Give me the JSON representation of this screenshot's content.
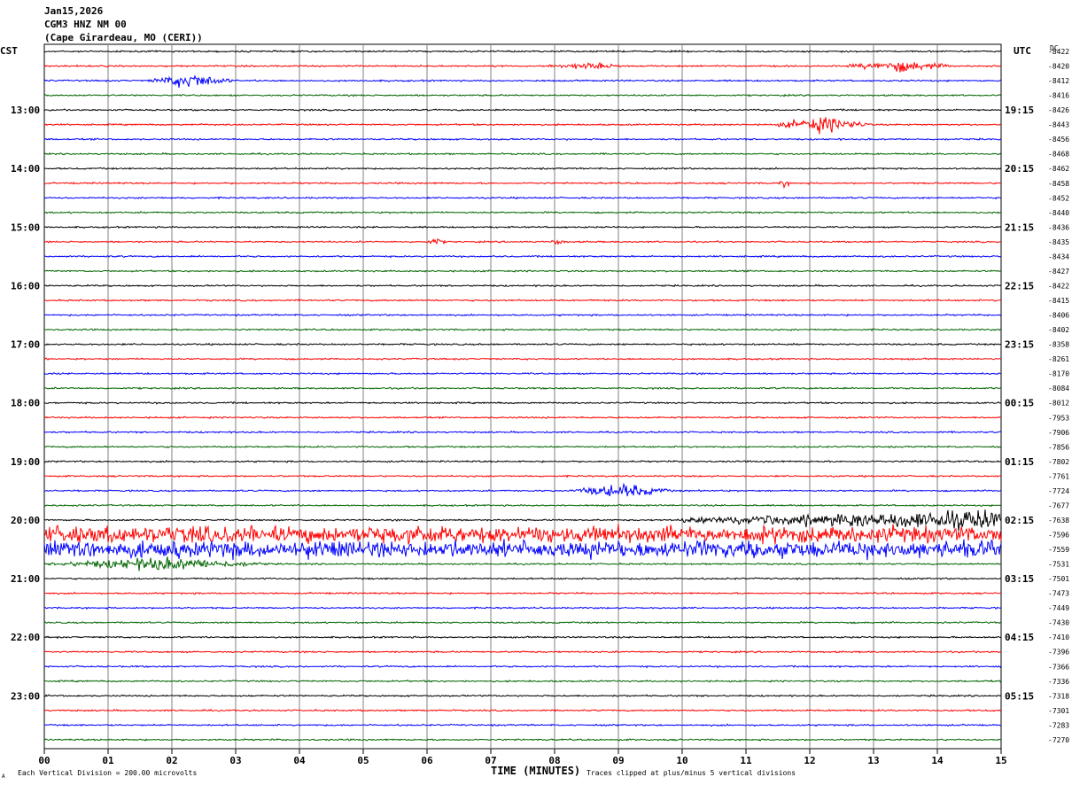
{
  "header": {
    "date": "Jan15,2026",
    "station": "CGM3 HNZ NM 00",
    "location": "(Cape Girardeau, MO (CERI))"
  },
  "left_axis_label": "CST",
  "right_axis_label": "UTC",
  "dc_label": "DC",
  "footer": {
    "scale_note": "Each Vertical Division =  200.00 microvolts",
    "clip_note": "Traces clipped at plus/minus 5 vertical divisions",
    "corner_mark": "A"
  },
  "chart_data": {
    "type": "line",
    "title": "",
    "xlabel": "TIME (MINUTES)",
    "xlim": [
      0,
      15
    ],
    "x_ticks": [
      "00",
      "01",
      "02",
      "03",
      "04",
      "05",
      "06",
      "07",
      "08",
      "09",
      "10",
      "11",
      "12",
      "13",
      "14",
      "15"
    ],
    "grid": true,
    "trace_colors": [
      "#000000",
      "#ff0000",
      "#0000ff",
      "#006400"
    ],
    "cst_labels": [
      "13:00",
      "14:00",
      "15:00",
      "16:00",
      "17:00",
      "18:00",
      "19:00",
      "20:00",
      "21:00",
      "22:00",
      "23:00"
    ],
    "utc_labels": [
      "19:15",
      "20:15",
      "21:15",
      "22:15",
      "23:15",
      "00:15",
      "01:15",
      "02:15",
      "03:15",
      "04:15",
      "05:15"
    ],
    "dc_offsets": [
      -8422,
      -8420,
      -8412,
      -8416,
      -8426,
      -8443,
      -8456,
      -8468,
      -8462,
      -8458,
      -8452,
      -8440,
      -8436,
      -8435,
      -8434,
      -8427,
      -8422,
      -8415,
      -8406,
      -8402,
      -8358,
      -8261,
      -8170,
      -8084,
      -8012,
      -7953,
      -7906,
      -7856,
      -7802,
      -7761,
      -7724,
      -7677,
      -7638,
      -7596,
      -7559,
      -7531,
      -7501,
      -7473,
      -7449,
      -7430,
      -7410,
      -7396,
      -7366,
      -7336,
      -7318,
      -7301,
      -7283,
      -7270
    ],
    "bursts": [
      {
        "trace": 1,
        "start_min": 7.8,
        "end_min": 9.2,
        "amplitude_div": 0.6
      },
      {
        "trace": 1,
        "start_min": 12.5,
        "end_min": 14.3,
        "amplitude_div": 1.2
      },
      {
        "trace": 2,
        "start_min": 1.6,
        "end_min": 3.0,
        "amplitude_div": 1.6
      },
      {
        "trace": 5,
        "start_min": 11.4,
        "end_min": 13.0,
        "amplitude_div": 1.8
      },
      {
        "trace": 9,
        "start_min": 11.5,
        "end_min": 11.7,
        "amplitude_div": 0.8
      },
      {
        "trace": 13,
        "start_min": 6.0,
        "end_min": 6.3,
        "amplitude_div": 0.7
      },
      {
        "trace": 13,
        "start_min": 7.9,
        "end_min": 8.2,
        "amplitude_div": 0.5
      },
      {
        "trace": 30,
        "start_min": 8.2,
        "end_min": 9.9,
        "amplitude_div": 1.5
      },
      {
        "trace": 32,
        "start_min": 10.0,
        "end_min": 15.0,
        "amplitude_div": 2.2
      },
      {
        "trace": 33,
        "start_min": 0.0,
        "end_min": 15.0,
        "amplitude_div": 2.0
      },
      {
        "trace": 34,
        "start_min": 0.0,
        "end_min": 15.0,
        "amplitude_div": 2.0
      },
      {
        "trace": 35,
        "start_min": 0.0,
        "end_min": 3.6,
        "amplitude_div": 1.4
      }
    ]
  }
}
